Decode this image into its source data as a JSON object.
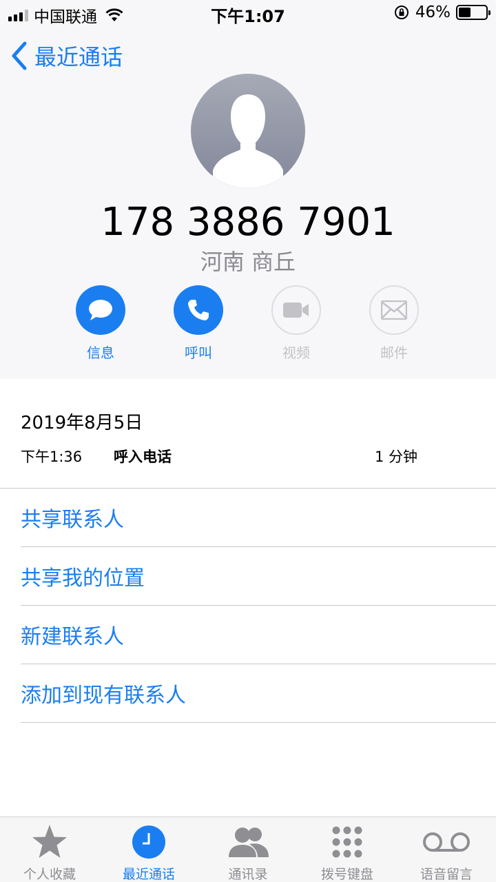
{
  "status_bar": {
    "carrier": "中国联通",
    "time": "下午1:07",
    "battery_percent": "46%",
    "battery_level": 0.46
  },
  "nav": {
    "back_label": "最近通话"
  },
  "contact": {
    "number": "178 3886 7901",
    "location": "河南 商丘"
  },
  "actions": [
    {
      "label": "信息",
      "icon": "message-icon",
      "enabled": true
    },
    {
      "label": "呼叫",
      "icon": "phone-icon",
      "enabled": true
    },
    {
      "label": "视频",
      "icon": "video-icon",
      "enabled": false
    },
    {
      "label": "邮件",
      "icon": "mail-icon",
      "enabled": false
    }
  ],
  "call_log": {
    "date": "2019年8月5日",
    "time": "下午1:36",
    "type": "呼入电话",
    "duration": "1 分钟"
  },
  "menu": [
    "共享联系人",
    "共享我的位置",
    "新建联系人",
    "添加到现有联系人"
  ],
  "tabs": [
    {
      "label": "个人收藏",
      "icon": "star-icon"
    },
    {
      "label": "最近通话",
      "icon": "clock-icon",
      "active": true
    },
    {
      "label": "通讯录",
      "icon": "contacts-icon"
    },
    {
      "label": "拨号键盘",
      "icon": "keypad-icon"
    },
    {
      "label": "语音留言",
      "icon": "voicemail-icon"
    }
  ],
  "colors": {
    "accent": "#1a7ef0",
    "inactive": "#c2c2c7",
    "background_top": "#f7f7f9"
  }
}
